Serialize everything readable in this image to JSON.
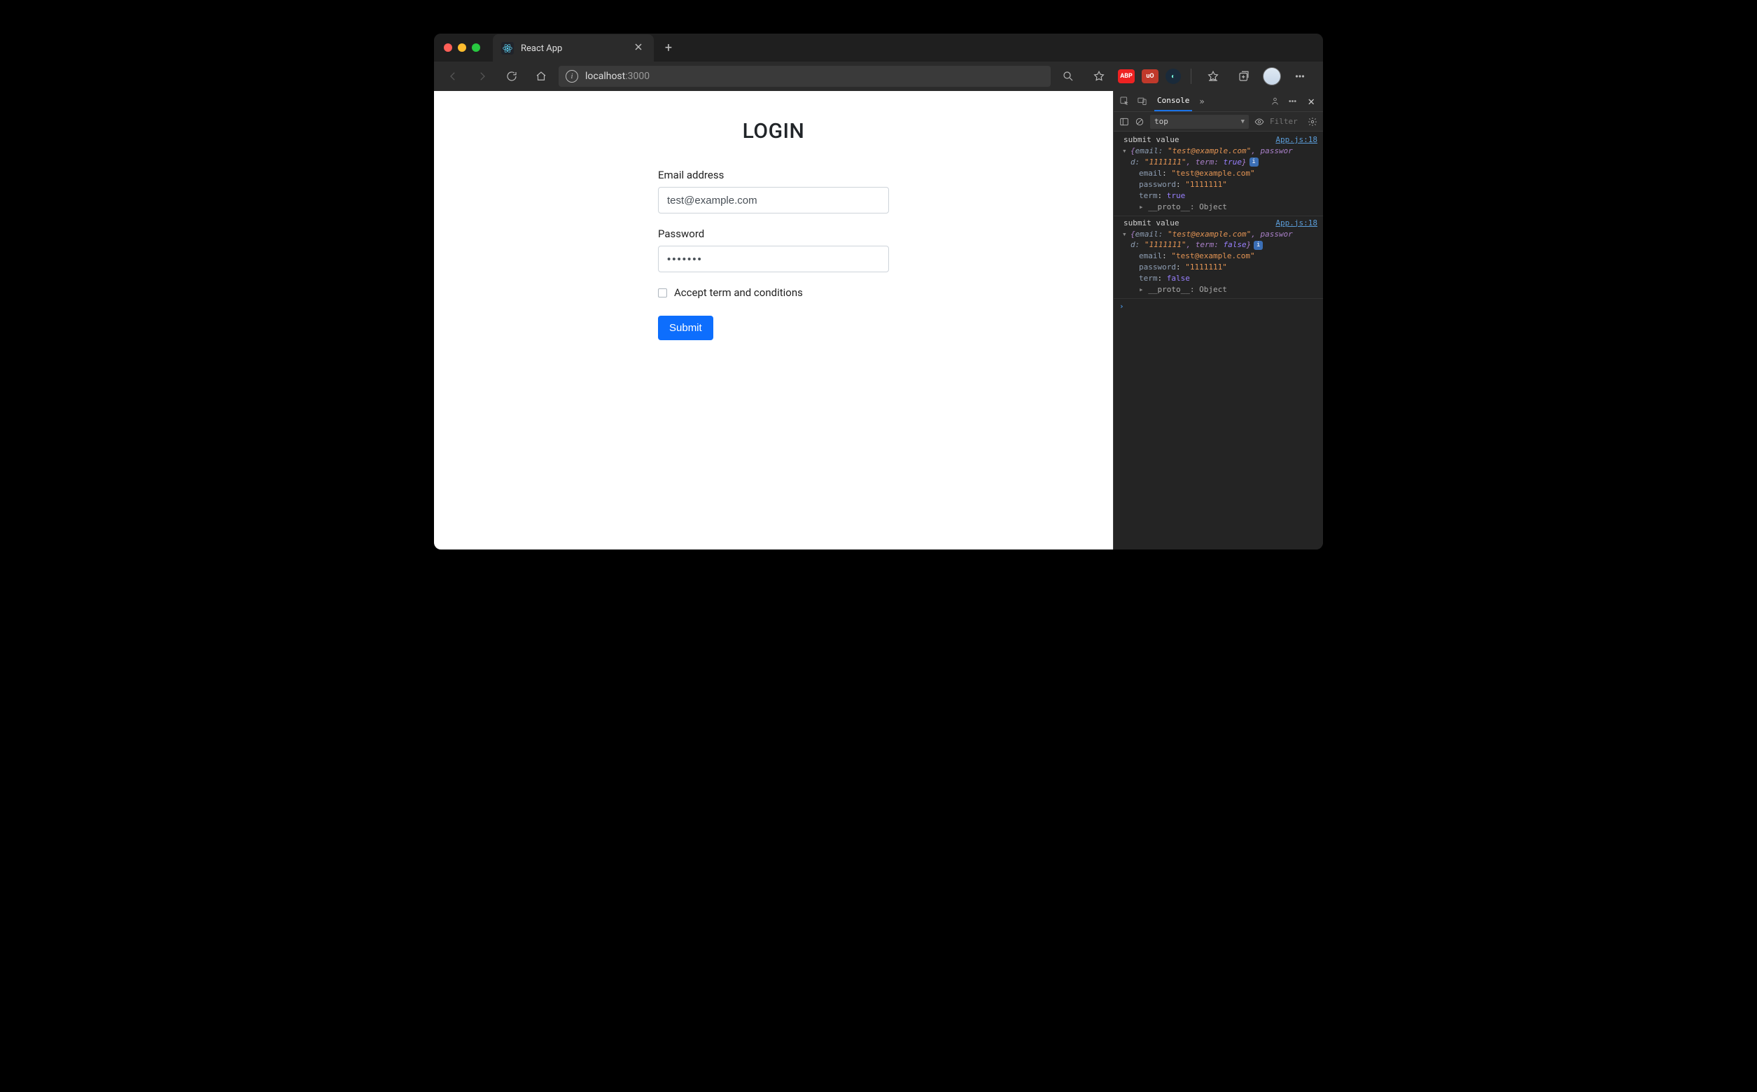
{
  "browser": {
    "tab_title": "React App",
    "url_host": "localhost",
    "url_port": ":3000"
  },
  "extensions": {
    "abp": "ABP",
    "ublock": "uO"
  },
  "form": {
    "title": "LOGIN",
    "email_label": "Email address",
    "email_value": "test@example.com",
    "password_label": "Password",
    "password_value": "•••••••",
    "terms_label": "Accept term and conditions",
    "submit_label": "Submit"
  },
  "devtools": {
    "tab_console": "Console",
    "context": "top",
    "filter_placeholder": "Filter",
    "logs": [
      {
        "label": "submit value",
        "source": "App.js:18",
        "summary_a": "{email: \"test@example.com\", passwor",
        "summary_b": "d: \"1111111\", term: true}",
        "kv": {
          "email": "\"test@example.com\"",
          "password": "\"1111111\"",
          "term": "true"
        },
        "proto": "__proto__: Object"
      },
      {
        "label": "submit value",
        "source": "App.js:18",
        "summary_a": "{email: \"test@example.com\", passwor",
        "summary_b": "d: \"1111111\", term: false}",
        "kv": {
          "email": "\"test@example.com\"",
          "password": "\"1111111\"",
          "term": "false"
        },
        "proto": "__proto__: Object"
      }
    ]
  }
}
